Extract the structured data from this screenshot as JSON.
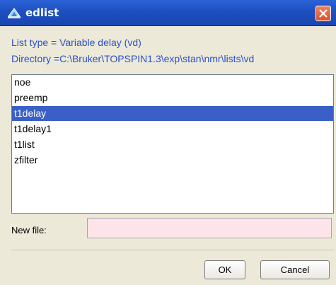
{
  "window": {
    "title": "edlist"
  },
  "info": {
    "list_type": "List type = Variable delay (vd)",
    "directory": "Directory =C:\\Bruker\\TOPSPIN1.3\\exp\\stan\\nmr\\lists\\vd"
  },
  "list": {
    "items": [
      {
        "label": "noe",
        "selected": false
      },
      {
        "label": "preemp",
        "selected": false
      },
      {
        "label": "t1delay",
        "selected": true
      },
      {
        "label": "t1delay1",
        "selected": false
      },
      {
        "label": "t1list",
        "selected": false
      },
      {
        "label": "zfilter",
        "selected": false
      }
    ]
  },
  "new_file": {
    "label": "New file:",
    "value": ""
  },
  "buttons": {
    "ok_label": "OK",
    "cancel_label": "Cancel"
  },
  "colors": {
    "titlebar": "#2b63d6",
    "info_text": "#2b4fcf",
    "selection": "#3a5fc7",
    "input_bg": "#fce4ea",
    "close_button": "#d9522e"
  },
  "icons": {
    "app": "bruker-topspin-icon",
    "close": "close-icon"
  }
}
